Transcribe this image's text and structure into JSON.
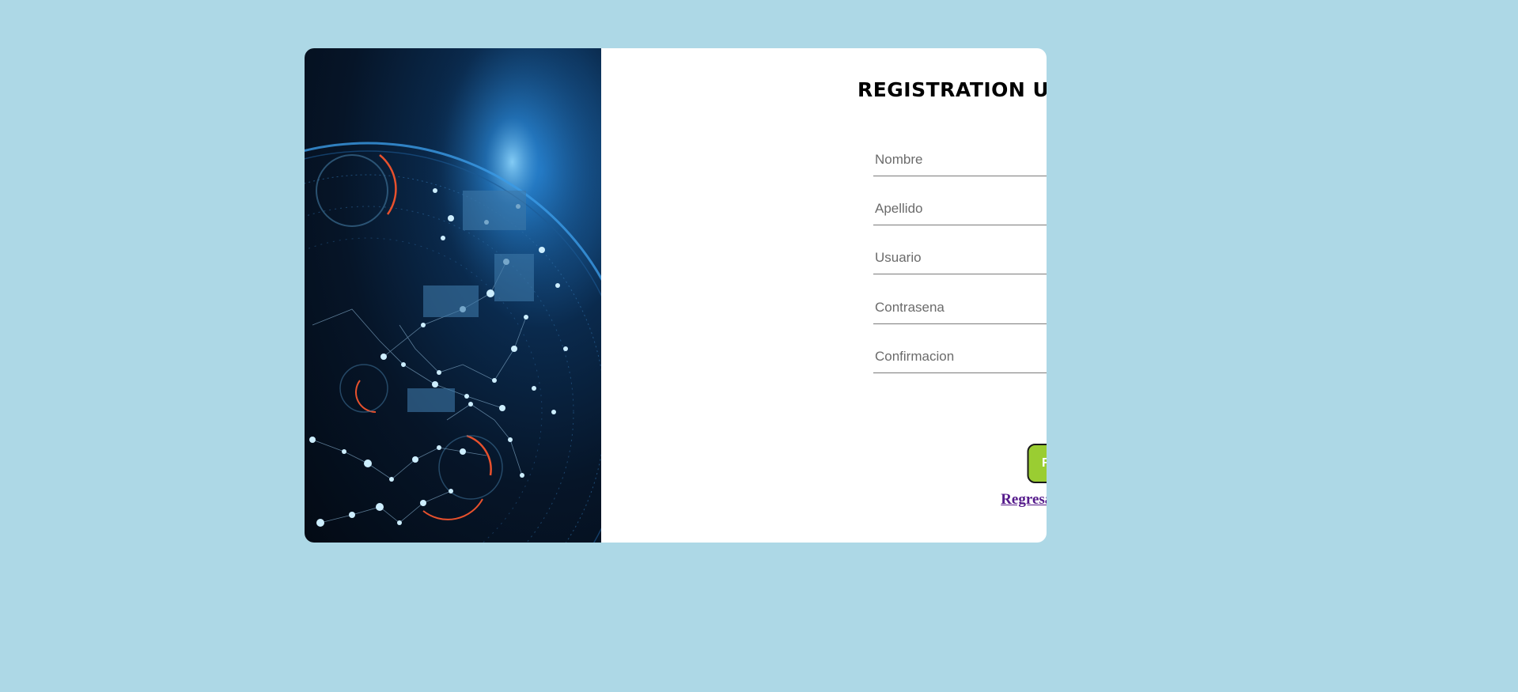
{
  "form": {
    "title": "REGISTRATION USUARIO",
    "fields": [
      {
        "placeholder": "Nombre",
        "value": ""
      },
      {
        "placeholder": "Apellido",
        "value": ""
      },
      {
        "placeholder": "Usuario",
        "value": ""
      },
      {
        "placeholder": "Contrasena",
        "value": ""
      },
      {
        "placeholder": "Confirmacion",
        "value": ""
      }
    ],
    "submit_label": "Registrarse",
    "back_link_label": "Regresar a inicio de sesion"
  },
  "colors": {
    "background": "#add8e6",
    "card": "#ffffff",
    "button": "#9acd32",
    "link": "#551a8b"
  },
  "hero_image": "globe-network-image"
}
